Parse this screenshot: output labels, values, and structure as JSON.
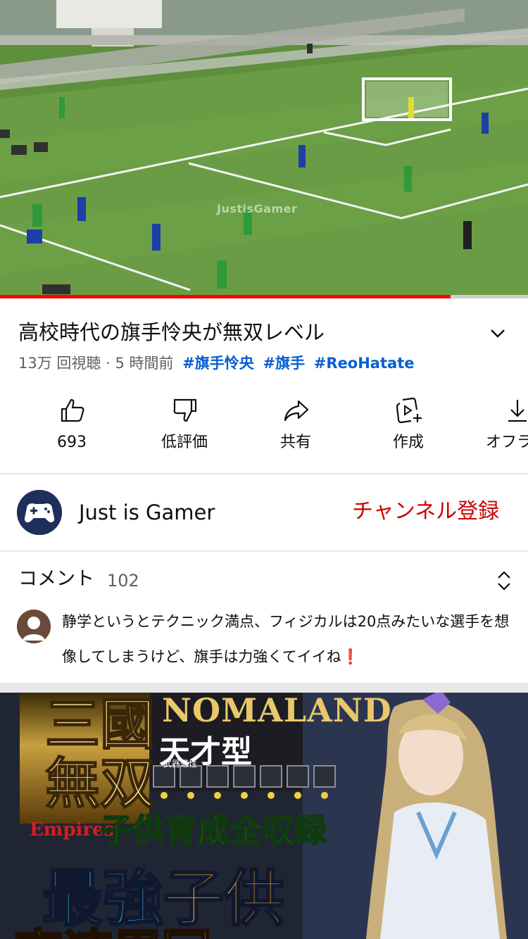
{
  "video": {
    "watermark": "JustisGamer",
    "progress_fraction": 0.853,
    "title": "高校時代の旗手怜央が無双レベル",
    "views": "13万 回視聴",
    "separator": "·",
    "age": "5 時間前",
    "hashtags": [
      "#旗手怜央",
      "#旗手",
      "#ReoHatate"
    ]
  },
  "actions": [
    {
      "label": "693",
      "icon": "like-icon"
    },
    {
      "label": "低評価",
      "icon": "dislike-icon"
    },
    {
      "label": "共有",
      "icon": "share-icon"
    },
    {
      "label": "作成",
      "icon": "create-icon"
    },
    {
      "label": "オフライ",
      "icon": "download-icon"
    }
  ],
  "channel": {
    "name": "Just is Gamer",
    "subscribe_label": "チャンネル登録"
  },
  "comments": {
    "label": "コメント",
    "count": "102",
    "top_comment": "静学というとテクニック満点、フィジカルは20点みたいな選手を想像してしまうけど、旗手は力強くてイイね",
    "top_comment_emoji": "❗"
  },
  "next_video": {
    "brand": "NOMALAND",
    "type_text": "天才型",
    "weapon_label": "武器適性",
    "badge_text": "三國無双",
    "badge_sub": "Empires",
    "line1": "子供育成全収録",
    "line2_a": "最強",
    "line2_b": "子供",
    "line3": "高速周回"
  },
  "colors": {
    "accent_red": "#ff0000",
    "subscribe_red": "#cc0000",
    "hashtag_blue": "#065fd4",
    "meta_gray": "#606060"
  }
}
